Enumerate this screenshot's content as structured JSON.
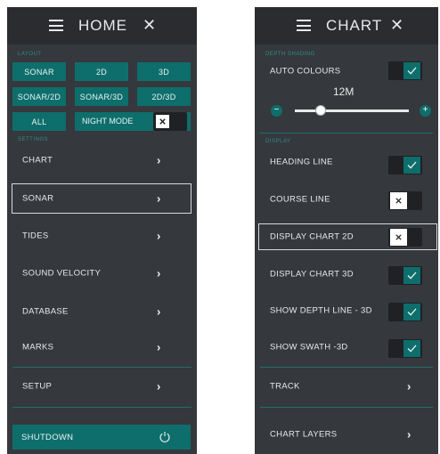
{
  "home": {
    "title": "HOME",
    "layout_label": "LAYOUT",
    "layout_buttons": [
      "SONAR",
      "2D",
      "3D",
      "SONAR/2D",
      "SONAR/3D",
      "2D/3D",
      "ALL"
    ],
    "night_mode": {
      "label": "NIGHT MODE",
      "state": "off"
    },
    "settings_label": "SETTINGS",
    "items": [
      "CHART",
      "SONAR",
      "TIDES",
      "SOUND VELOCITY",
      "DATABASE",
      "MARKS",
      "SETUP"
    ],
    "shutdown": "SHUTDOWN"
  },
  "chart": {
    "title": "CHART",
    "depth_label": "DEPTH SHADING",
    "auto_colours": {
      "label": "AUTO COLOURS",
      "state": "on"
    },
    "depth_value": "12M",
    "slider_fraction": 0.22,
    "display_label": "DISPLAY",
    "toggles": [
      {
        "label": "HEADING LINE",
        "state": "on"
      },
      {
        "label": "COURSE LINE",
        "state": "off"
      },
      {
        "label": "DISPLAY CHART 2D",
        "state": "off"
      },
      {
        "label": "DISPLAY CHART 3D",
        "state": "on"
      },
      {
        "label": "SHOW DEPTH LINE  - 3D",
        "state": "on"
      },
      {
        "label": "SHOW SWATH -3D",
        "state": "on"
      }
    ],
    "nav_items": [
      "TRACK",
      "CHART LAYERS"
    ]
  },
  "icons": {
    "menu": "hamburger-icon",
    "close": "close-icon",
    "chevron": "chevron-right-icon",
    "power": "power-icon",
    "check": "check-icon",
    "x": "x-mark-icon"
  },
  "colors": {
    "panel": "#35383c",
    "header": "#2a2c30",
    "accent": "#0e6e6c",
    "section": "#2f8c8a"
  }
}
